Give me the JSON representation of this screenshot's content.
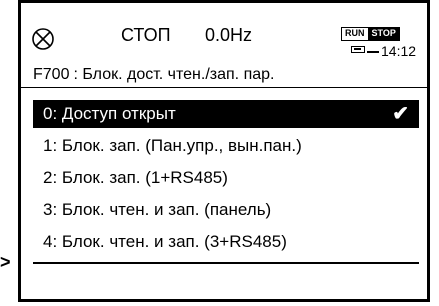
{
  "status": {
    "state": "СТОП",
    "frequency": "0.0Hz",
    "run_label": "RUN",
    "stop_label": "STOP",
    "time": "14:12"
  },
  "param_header": {
    "code": "F700",
    "title": ": Блок. дост. чтен./зап. пар."
  },
  "options": [
    {
      "label": "0: Доступ открыт",
      "selected": true
    },
    {
      "label": "1: Блок. зап. (Пан.упр., вын.пан.)",
      "selected": false
    },
    {
      "label": "2: Блок. зап. (1+RS485)",
      "selected": false
    },
    {
      "label": "3: Блок. чтен. и зап. (панель)",
      "selected": false
    },
    {
      "label": "4: Блок. чтен. и зап. (3+RS485)",
      "selected": false
    }
  ],
  "check_glyph": "✔",
  "pointer_glyph": ">",
  "colors": {
    "background": "#ffffff",
    "foreground": "#000000"
  }
}
